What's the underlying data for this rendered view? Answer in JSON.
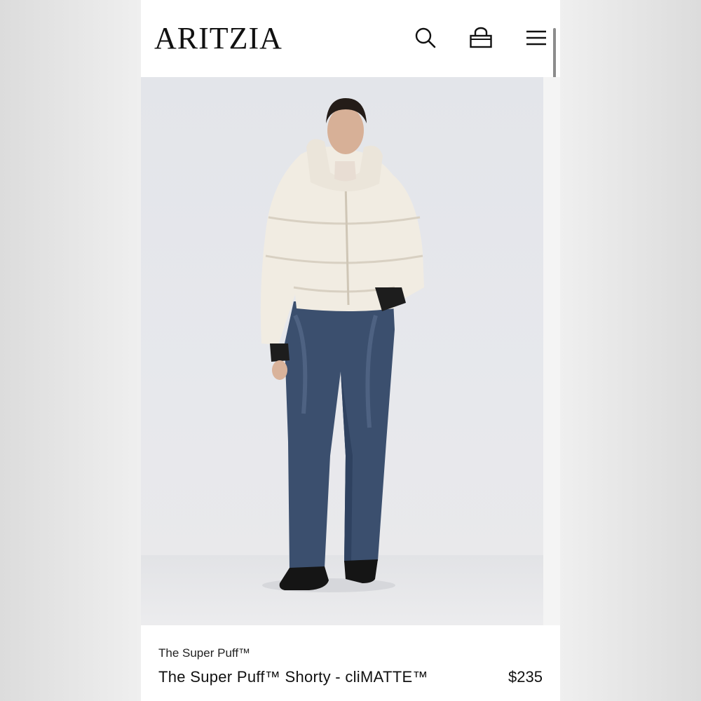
{
  "header": {
    "logo": "ARITZIA",
    "icons": [
      "search-icon",
      "shopping-bag-icon",
      "hamburger-menu-icon"
    ]
  },
  "product": {
    "collection": "The Super Puff™",
    "name": "The Super Puff™ Shorty - cliMATTE™",
    "price": "$235",
    "image_description_colors": {
      "jacket": "#f1ece2",
      "jeans": "#3b4f6e",
      "shoes": "#151515"
    }
  }
}
